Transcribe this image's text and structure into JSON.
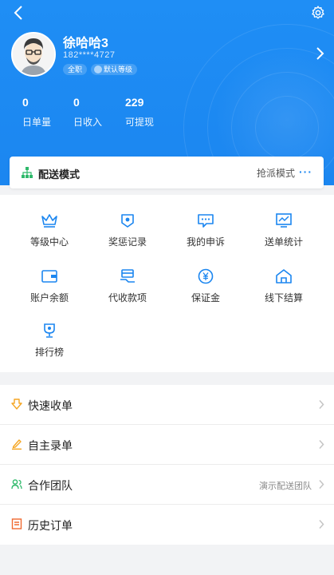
{
  "profile": {
    "name": "徐哈哈3",
    "phone": "182****4727",
    "badge_full": "全职",
    "badge_level": "默认等级"
  },
  "stats": [
    {
      "value": "0",
      "label": "日单量"
    },
    {
      "value": "0",
      "label": "日收入"
    },
    {
      "value": "229",
      "label": "可提现"
    }
  ],
  "delivery_mode": {
    "title": "配送模式",
    "value": "抢派模式",
    "more": "···"
  },
  "grid": [
    {
      "label": "等级中心",
      "icon": "crown-icon"
    },
    {
      "label": "奖惩记录",
      "icon": "shield-record-icon"
    },
    {
      "label": "我的申诉",
      "icon": "message-icon"
    },
    {
      "label": "送单统计",
      "icon": "chart-icon"
    },
    {
      "label": "账户余额",
      "icon": "wallet-icon"
    },
    {
      "label": "代收款项",
      "icon": "payment-icon"
    },
    {
      "label": "保证金",
      "icon": "yuan-icon"
    },
    {
      "label": "线下结算",
      "icon": "home-icon"
    },
    {
      "label": "排行榜",
      "icon": "trophy-icon"
    }
  ],
  "menu": [
    {
      "label": "快速收单",
      "sub": "",
      "icon": "fast-receive-icon"
    },
    {
      "label": "自主录单",
      "sub": "",
      "icon": "edit-icon"
    },
    {
      "label": "合作团队",
      "sub": "演示配送团队",
      "icon": "team-icon"
    },
    {
      "label": "历史订单",
      "sub": "",
      "icon": "history-icon"
    }
  ],
  "colors": {
    "primary": "#1b86f0",
    "accent_orange": "#f5a623",
    "accent_green": "#2fb96b"
  }
}
